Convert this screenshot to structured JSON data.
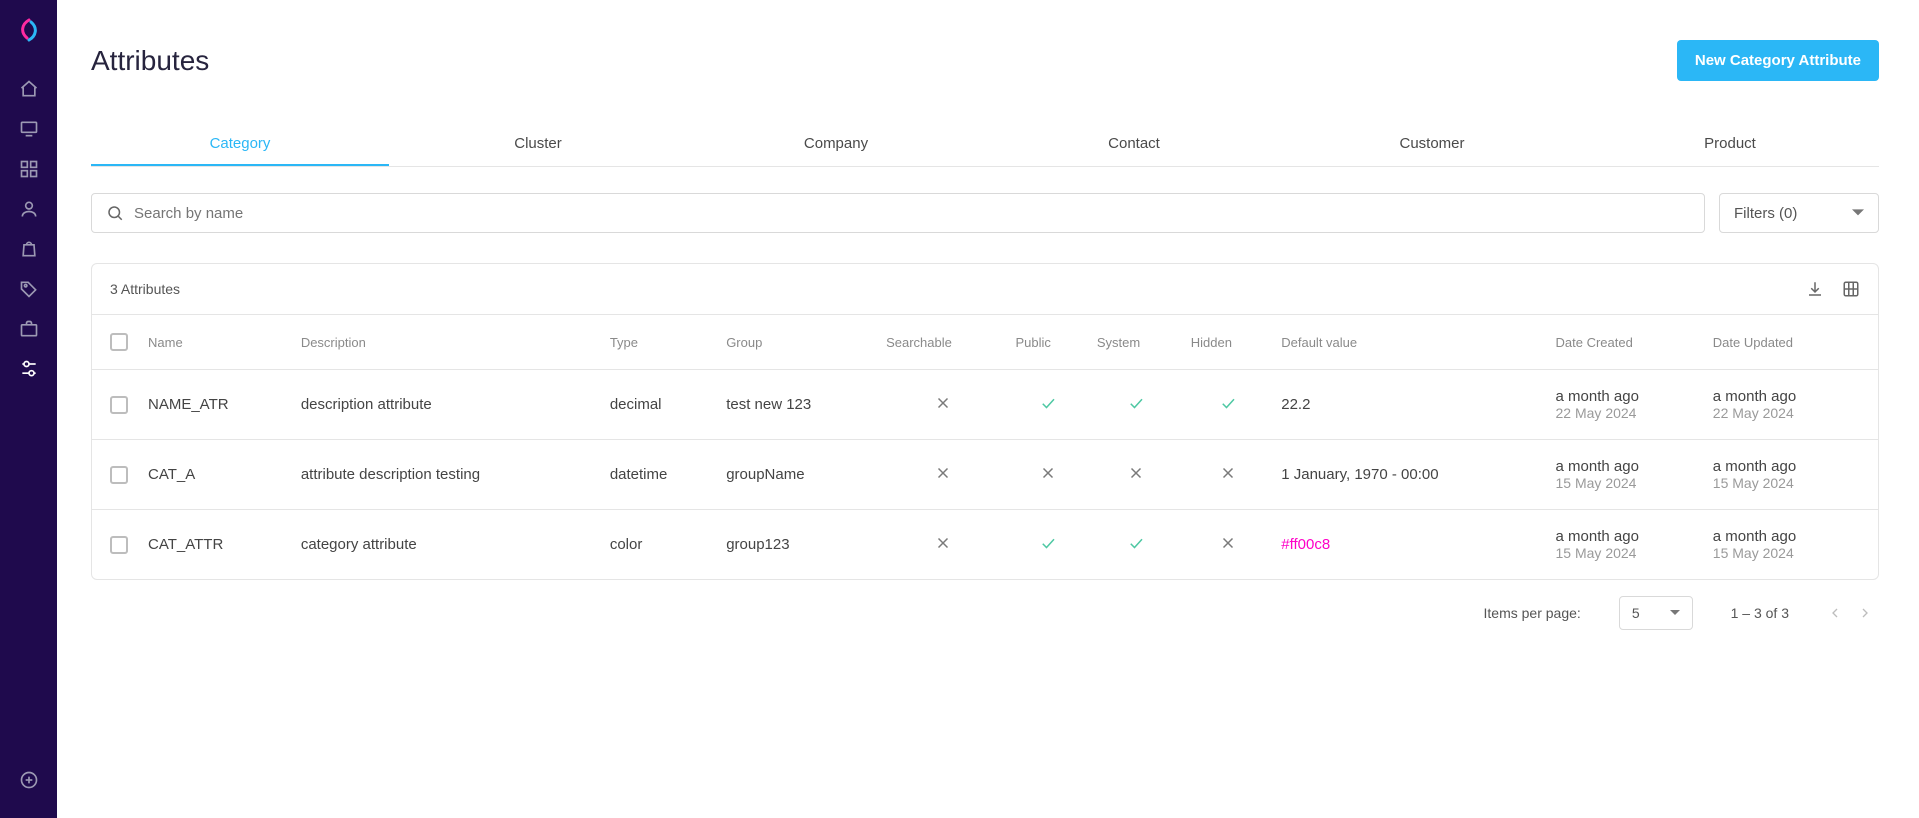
{
  "page": {
    "title": "Attributes",
    "new_button": "New Category Attribute"
  },
  "tabs": [
    "Category",
    "Cluster",
    "Company",
    "Contact",
    "Customer",
    "Product"
  ],
  "active_tab_index": 0,
  "search": {
    "placeholder": "Search by name"
  },
  "filters": {
    "label": "Filters (0)"
  },
  "table": {
    "title": "3 Attributes",
    "columns": [
      "Name",
      "Description",
      "Type",
      "Group",
      "Searchable",
      "Public",
      "System",
      "Hidden",
      "Default value",
      "Date Created",
      "Date Updated"
    ],
    "rows": [
      {
        "name": "NAME_ATR",
        "description": "description attribute",
        "type": "decimal",
        "group": "test new 123",
        "searchable": false,
        "public": true,
        "system": true,
        "hidden": true,
        "default": "22.2",
        "created": {
          "rel": "a month ago",
          "abs": "22 May 2024"
        },
        "updated": {
          "rel": "a month ago",
          "abs": "22 May 2024"
        }
      },
      {
        "name": "CAT_A",
        "description": "attribute description testing",
        "type": "datetime",
        "group": "groupName",
        "searchable": false,
        "public": false,
        "system": false,
        "hidden": false,
        "default": "1 January, 1970 - 00:00",
        "created": {
          "rel": "a month ago",
          "abs": "15 May 2024"
        },
        "updated": {
          "rel": "a month ago",
          "abs": "15 May 2024"
        }
      },
      {
        "name": "CAT_ATTR",
        "description": "category attribute",
        "type": "color",
        "group": "group123",
        "searchable": false,
        "public": true,
        "system": true,
        "hidden": false,
        "default": "#ff00c8",
        "default_is_color": true,
        "created": {
          "rel": "a month ago",
          "abs": "15 May 2024"
        },
        "updated": {
          "rel": "a month ago",
          "abs": "15 May 2024"
        }
      }
    ]
  },
  "pagination": {
    "items_per_page_label": "Items per page:",
    "items_per_page_value": "5",
    "range": "1 – 3 of 3"
  },
  "sidebar_icons": [
    "home-icon",
    "monitor-icon",
    "grid-icon",
    "user-icon",
    "bag-icon",
    "tag-icon",
    "briefcase-icon",
    "settings-icon"
  ],
  "selected_sidebar_index": 7
}
